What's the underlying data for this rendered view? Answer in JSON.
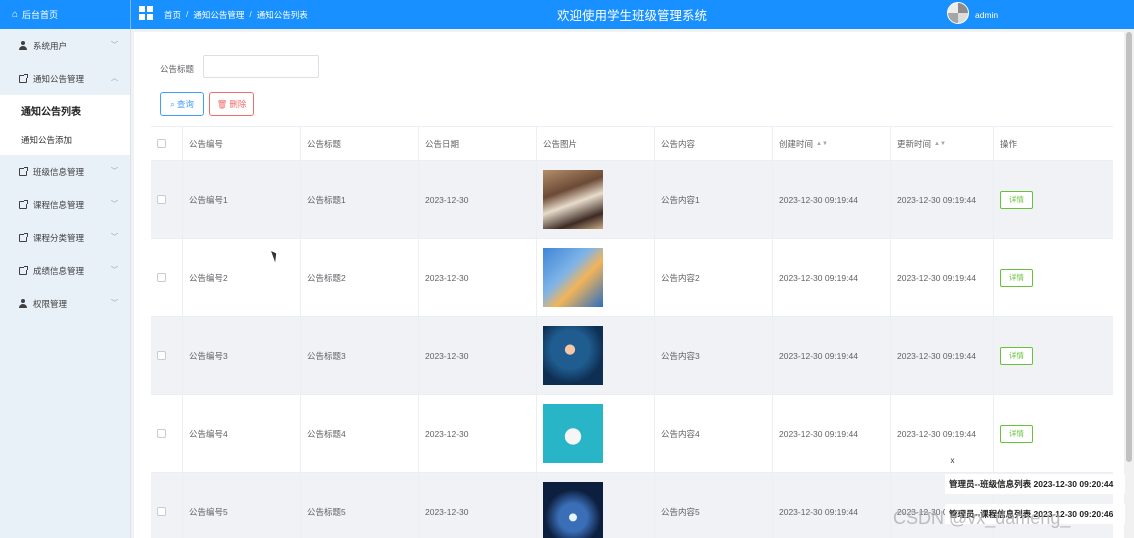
{
  "header": {
    "brand_label": "后台首页",
    "breadcrumb": [
      "首页",
      "通知公告管理",
      "通知公告列表"
    ],
    "breadcrumb_sep": "/",
    "title": "欢迎使用学生班级管理系统",
    "user": "admin",
    "bg_color": "#1890ff"
  },
  "sidebar": {
    "items": [
      {
        "label": "系统用户",
        "icon": "user-icon",
        "expanded": false
      },
      {
        "label": "通知公告管理",
        "icon": "document-icon",
        "expanded": true,
        "children": [
          {
            "label": "通知公告列表",
            "active": true
          },
          {
            "label": "通知公告添加",
            "active": false
          }
        ]
      },
      {
        "label": "班级信息管理",
        "icon": "document-icon",
        "expanded": false
      },
      {
        "label": "课程信息管理",
        "icon": "document-icon",
        "expanded": false
      },
      {
        "label": "课程分类管理",
        "icon": "document-icon",
        "expanded": false
      },
      {
        "label": "成绩信息管理",
        "icon": "document-icon",
        "expanded": false
      },
      {
        "label": "权限管理",
        "icon": "user-icon",
        "expanded": false
      }
    ]
  },
  "search": {
    "label": "公告标题",
    "value": "",
    "query_button": "查询",
    "delete_button": "删除"
  },
  "table": {
    "columns": [
      "公告编号",
      "公告标题",
      "公告日期",
      "公告图片",
      "公告内容",
      "创建时间",
      "更新时间",
      "操作"
    ],
    "sortable": [
      "创建时间",
      "更新时间"
    ],
    "rows": [
      {
        "code": "公告编号1",
        "title": "公告标题1",
        "date": "2023-12-30",
        "content": "公告内容1",
        "created": "2023-12-30 09:19:44",
        "updated": "2023-12-30 09:19:44",
        "action": "详情"
      },
      {
        "code": "公告编号2",
        "title": "公告标题2",
        "date": "2023-12-30",
        "content": "公告内容2",
        "created": "2023-12-30 09:19:44",
        "updated": "2023-12-30 09:19:44",
        "action": "详情"
      },
      {
        "code": "公告编号3",
        "title": "公告标题3",
        "date": "2023-12-30",
        "content": "公告内容3",
        "created": "2023-12-30 09:19:44",
        "updated": "2023-12-30 09:19:44",
        "action": "详情"
      },
      {
        "code": "公告编号4",
        "title": "公告标题4",
        "date": "2023-12-30",
        "content": "公告内容4",
        "created": "2023-12-30 09:19:44",
        "updated": "2023-12-30 09:19:44",
        "action": "详情"
      },
      {
        "code": "公告编号5",
        "title": "公告标题5",
        "date": "2023-12-30",
        "content": "公告内容5",
        "created": "2023-12-30 09:19:44",
        "updated": "2023-12-30 09:",
        "action": ""
      }
    ]
  },
  "notifications": {
    "close": "x",
    "items": [
      "管理员--班级信息列表 2023-12-30 09:20:44",
      "管理员--课程信息列表 2023-12-30 09:20:46"
    ]
  },
  "watermark": "CSDN @vx_dameng_"
}
